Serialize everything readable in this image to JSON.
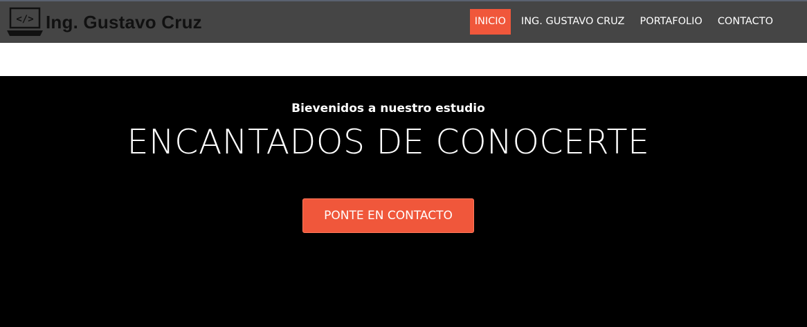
{
  "brand": {
    "icon": "laptop-code-icon",
    "icon_glyph": "</>",
    "name": "Ing. Gustavo Cruz"
  },
  "nav": {
    "items": [
      {
        "label": "INICIO",
        "active": true
      },
      {
        "label": "ING. GUSTAVO CRUZ",
        "active": false
      },
      {
        "label": "PORTAFOLIO",
        "active": false
      },
      {
        "label": "CONTACTO",
        "active": false
      }
    ]
  },
  "hero": {
    "welcome": "Bievenidos a nuestro estudio",
    "headline": "ENCANTADOS DE CONOCERTE",
    "cta_label": "PONTE EN CONTACTO"
  },
  "colors": {
    "navbar_bg": "#454545",
    "accent": "#f0573b",
    "hero_bg": "#000000",
    "band_bg": "#ffffff"
  }
}
